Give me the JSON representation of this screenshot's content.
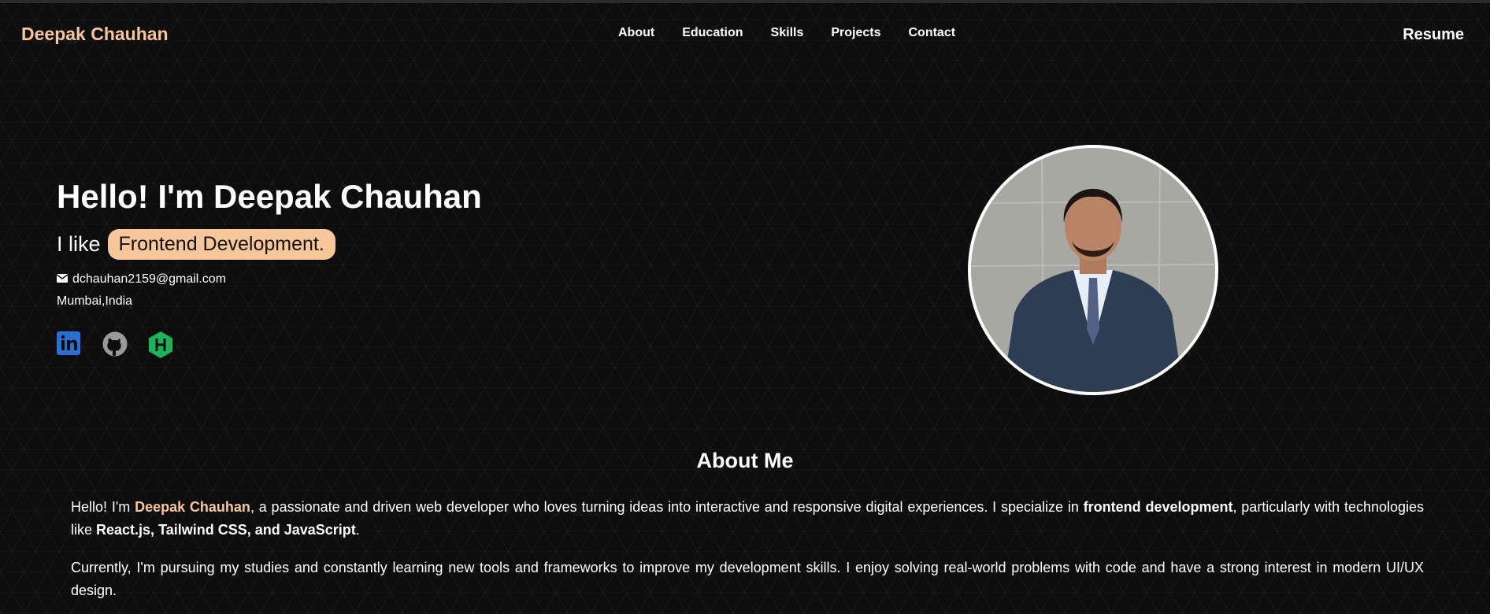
{
  "header": {
    "brand": "Deepak Chauhan",
    "nav": [
      "About",
      "Education",
      "Skills",
      "Projects",
      "Contact"
    ],
    "resume_label": "Resume"
  },
  "hero": {
    "title": "Hello! I'm Deepak Chauhan",
    "like_prefix": "I like",
    "like_highlight": "Frontend Development.",
    "email": "dchauhan2159@gmail.com",
    "location": "Mumbai,India",
    "socials": [
      "linkedin-icon",
      "github-icon",
      "hackerrank-icon"
    ]
  },
  "about": {
    "title": "About Me",
    "p1_a": "Hello! I'm ",
    "p1_name": "Deepak Chauhan",
    "p1_b": ", a passionate and driven web developer who loves turning ideas into interactive and responsive digital experiences. I specialize in ",
    "p1_bold": "frontend development",
    "p1_c": ", particularly with technologies like ",
    "p1_tech": "React.js, Tailwind CSS, and JavaScript",
    "p1_d": ".",
    "p2": "Currently, I'm pursuing my studies and constantly learning new tools and frameworks to improve my development skills. I enjoy solving real-world problems with code and have a strong interest in modern UI/UX design."
  },
  "colors": {
    "accent": "#f7c79a",
    "background": "#0d0d0d",
    "linkedin": "#2a6fd6",
    "hackerrank": "#1bb35a"
  }
}
